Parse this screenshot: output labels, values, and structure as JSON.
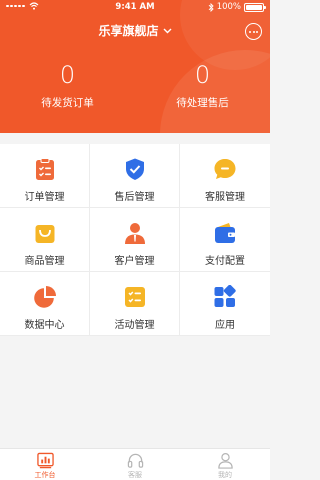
{
  "status_bar": {
    "time": "9:41 AM",
    "battery": "100%"
  },
  "header": {
    "store_name": "乐享旗舰店",
    "stats": [
      {
        "value": "0",
        "label": "待发货订单"
      },
      {
        "value": "0",
        "label": "待处理售后"
      }
    ]
  },
  "grid": [
    {
      "label": "订单管理",
      "icon": "order-clipboard-icon"
    },
    {
      "label": "售后管理",
      "icon": "shield-check-icon"
    },
    {
      "label": "客服管理",
      "icon": "chat-bubble-icon"
    },
    {
      "label": "商品管理",
      "icon": "shopping-bag-icon"
    },
    {
      "label": "客户管理",
      "icon": "customer-person-icon"
    },
    {
      "label": "支付配置",
      "icon": "wallet-icon"
    },
    {
      "label": "数据中心",
      "icon": "pie-chart-icon"
    },
    {
      "label": "活动管理",
      "icon": "activity-checklist-icon"
    },
    {
      "label": "应用",
      "icon": "apps-grid-icon"
    }
  ],
  "tabbar": [
    {
      "label": "工作台",
      "icon": "workbench-chart-icon",
      "active": true
    },
    {
      "label": "客服",
      "icon": "headset-icon",
      "active": false
    },
    {
      "label": "我的",
      "icon": "profile-icon",
      "active": false
    }
  ],
  "colors": {
    "primary": "#f0582a",
    "order": "#ef6a3a",
    "shield": "#2f6ee6",
    "chat": "#f5b526",
    "bag": "#f5b526",
    "customer": "#ef6a3a",
    "wallet": "#2f6ee6",
    "pie": "#ef6a3a",
    "activity": "#f5b526",
    "apps": "#2f6ee6"
  }
}
